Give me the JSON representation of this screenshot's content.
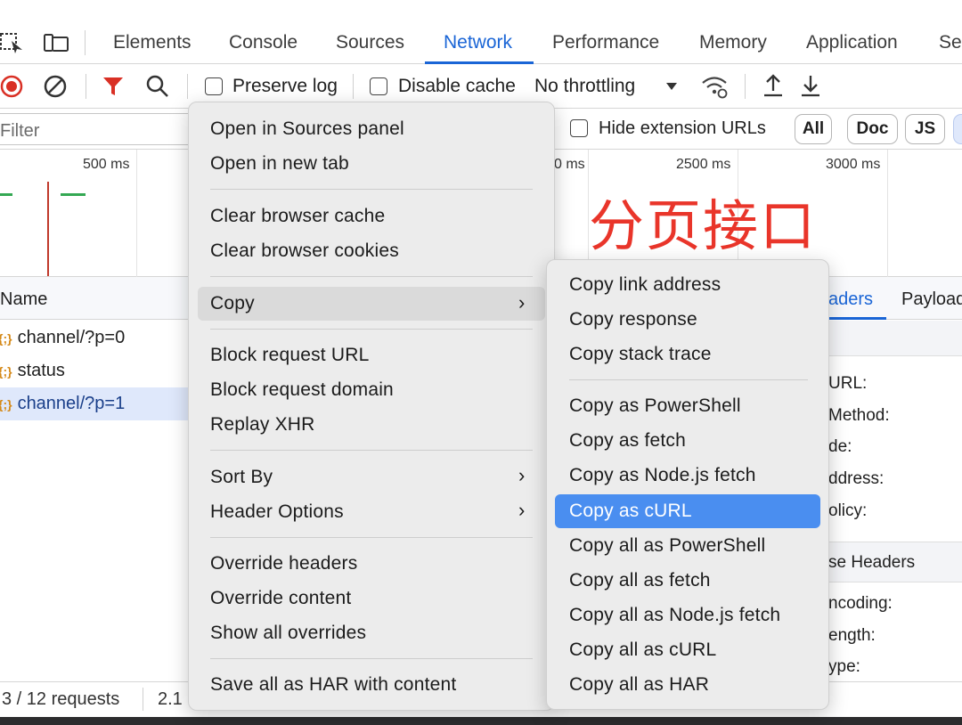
{
  "tabs": [
    "Elements",
    "Console",
    "Sources",
    "Network",
    "Performance",
    "Memory",
    "Application",
    "Se"
  ],
  "toolbar": {
    "preserve_log": "Preserve log",
    "disable_cache": "Disable cache",
    "throttling": "No throttling"
  },
  "filter": {
    "placeholder": "Filter",
    "hide_ext": "Hide extension URLs",
    "pills": [
      "All",
      "Doc",
      "JS"
    ]
  },
  "timeline": {
    "ticks": [
      "500 ms",
      "0 ms",
      "2500 ms",
      "3000 ms"
    ],
    "annotation": "分页接口"
  },
  "requests": {
    "header": "Name",
    "rows": [
      "channel/?p=0",
      "status",
      "channel/?p=1"
    ]
  },
  "details": {
    "tabs": [
      "aders",
      "Payload"
    ],
    "lines": [
      "URL:",
      "Method:",
      "de:",
      "ddress:",
      "olicy:"
    ],
    "section": "se Headers",
    "resp_lines": [
      "ncoding:",
      "ength:",
      "ype:"
    ]
  },
  "status": {
    "requests": "3 / 12 requests",
    "transferred": "2.1"
  },
  "menu": {
    "items": [
      "Open in Sources panel",
      "Open in new tab",
      "Clear browser cache",
      "Clear browser cookies",
      "Copy",
      "Block request URL",
      "Block request domain",
      "Replay XHR",
      "Sort By",
      "Header Options",
      "Override headers",
      "Override content",
      "Show all overrides",
      "Save all as HAR with content"
    ]
  },
  "submenu": {
    "items": [
      "Copy link address",
      "Copy response",
      "Copy stack trace",
      "Copy as PowerShell",
      "Copy as fetch",
      "Copy as Node.js fetch",
      "Copy as cURL",
      "Copy all as PowerShell",
      "Copy all as fetch",
      "Copy all as Node.js fetch",
      "Copy all as cURL",
      "Copy all as HAR"
    ]
  },
  "colors": {
    "accent": "#1a65d6",
    "highlight": "#4a8ef0",
    "annotation": "#e9352a",
    "record": "#d93025",
    "filter_icon": "#d93025"
  }
}
